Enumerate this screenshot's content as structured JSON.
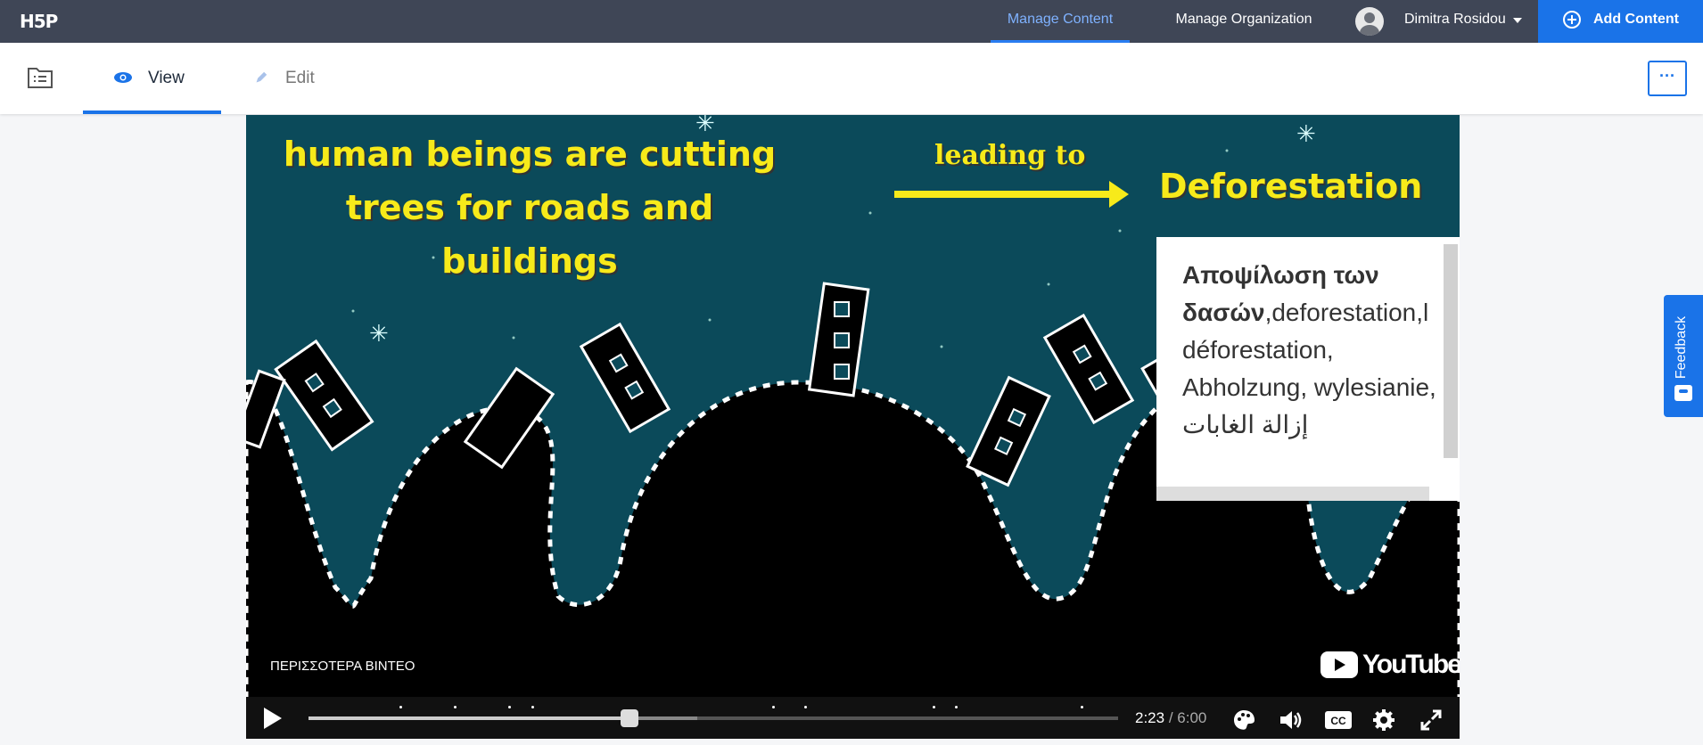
{
  "topbar": {
    "logo": "H5P",
    "nav": {
      "manage_content": "Manage Content",
      "manage_organization": "Manage Organization"
    },
    "user_name": "Dimitra Rosidou",
    "add_content": "Add Content"
  },
  "toolbar": {
    "tabs": {
      "view": "View",
      "edit": "Edit"
    },
    "more_label": "···"
  },
  "video": {
    "headline": "human beings are cutting trees for roads and buildings",
    "leading_to": "leading to",
    "result": "Deforestation",
    "more_videos": "ΠΕΡΙΣΣΟΤΕΡΑ ΒΙΝΤΕΟ",
    "youtube": "YouTube",
    "overlay": {
      "term_bold": "Αποψίλωση των δασών",
      "term_rest": ",deforestation,l déforestation, Abholzung, wylesianie, إزالة الغابات"
    },
    "controls": {
      "current_time": "2:23",
      "separator": "/",
      "duration": "6:00",
      "progress_fraction": 0.397,
      "buffered_fraction": 0.48
    }
  },
  "feedback": "Feedback",
  "colors": {
    "topbar": "#3f4656",
    "accent": "#1a73e8",
    "video_sky": "#0b4a5a",
    "caption_yellow": "#f7ea1a"
  }
}
